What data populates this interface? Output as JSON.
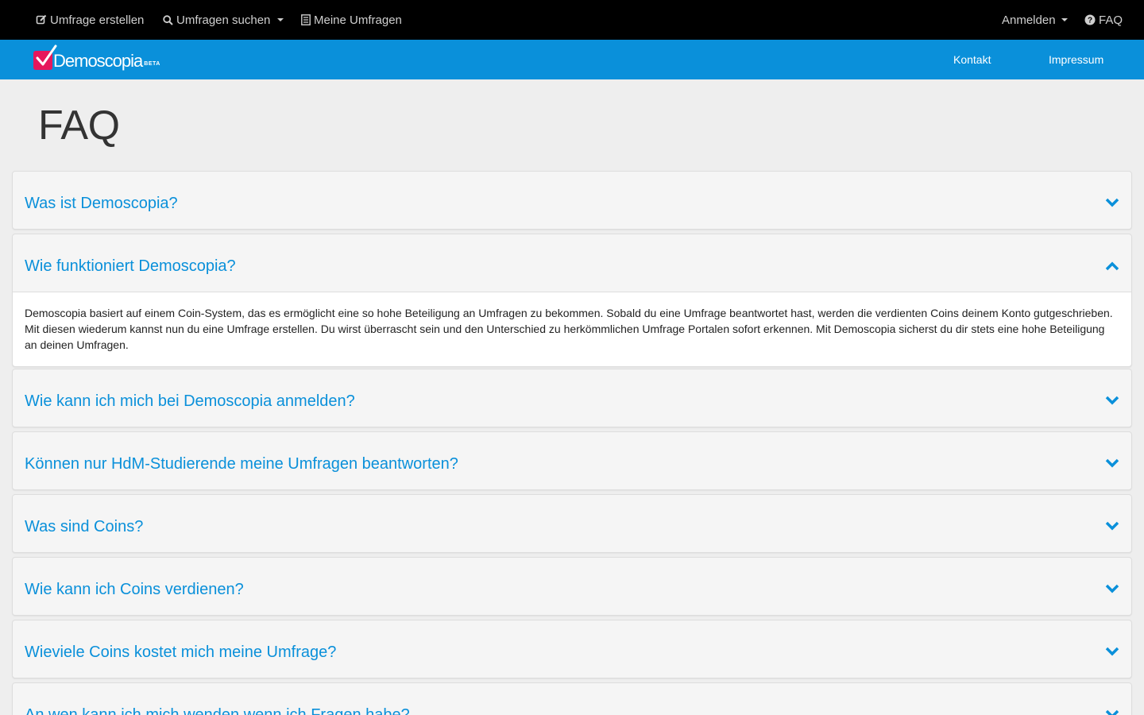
{
  "topnav": {
    "items": [
      {
        "label": "Umfrage erstellen",
        "icon": "edit-icon"
      },
      {
        "label": "Umfragen suchen",
        "icon": "search-icon"
      },
      {
        "label": "Meine Umfragen",
        "icon": "list-icon"
      }
    ],
    "login_label": "Anmelden",
    "faq_label": "FAQ"
  },
  "brand": {
    "name": "Demoscopia",
    "badge": "BETA",
    "links": {
      "kontakt": "Kontakt",
      "impressum": "Impressum"
    }
  },
  "page": {
    "title": "FAQ"
  },
  "faq": [
    {
      "question": "Was ist Demoscopia?",
      "expanded": false
    },
    {
      "question": "Wie funktioniert Demoscopia?",
      "expanded": true,
      "answer": "Demoscopia basiert auf einem Coin-System, das es ermöglicht eine so hohe Beteiligung an Umfragen zu bekommen. Sobald du eine Umfrage beantwortet hast, werden die verdienten Coins deinem Konto gutgeschrieben. Mit diesen wiederum kannst nun du eine Umfrage erstellen. Du wirst überrascht sein und den Unterschied zu herkömmlichen Umfrage Portalen sofort erkennen. Mit Demoscopia sicherst du dir stets eine hohe Beteiligung an deinen Umfragen."
    },
    {
      "question": "Wie kann ich mich bei Demoscopia anmelden?",
      "expanded": false
    },
    {
      "question": "Können nur HdM-Studierende meine Umfragen beantworten?",
      "expanded": false
    },
    {
      "question": "Was sind Coins?",
      "expanded": false
    },
    {
      "question": "Wie kann ich Coins verdienen?",
      "expanded": false
    },
    {
      "question": "Wieviele Coins kostet mich meine Umfrage?",
      "expanded": false
    },
    {
      "question": "An wen kann ich mich wenden wenn ich Fragen habe?",
      "expanded": false
    }
  ],
  "colors": {
    "accent": "#0a90da",
    "brand_red": "#e6175c",
    "topbar": "#000000"
  }
}
